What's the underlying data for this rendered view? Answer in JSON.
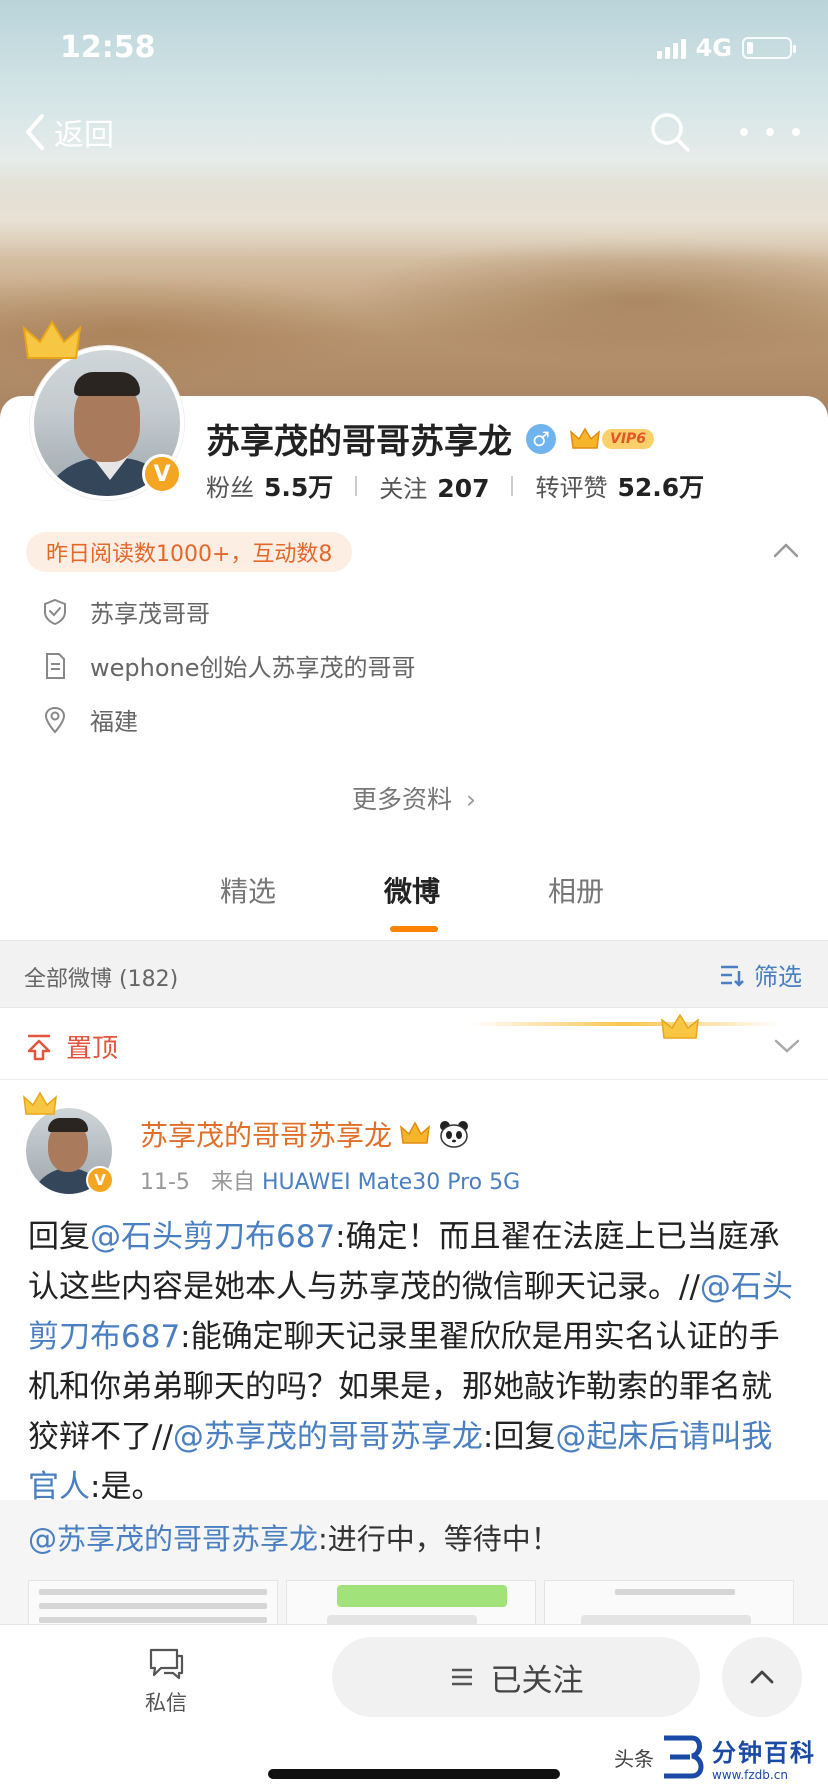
{
  "status_bar": {
    "time": "12:58",
    "network": "4G",
    "battery_level": 0.15
  },
  "nav": {
    "back_label": "返回"
  },
  "profile": {
    "name": "苏享茂的哥哥苏享龙",
    "gender_symbol": "♂",
    "verified_mark": "V",
    "vip_label": "VIP6",
    "stats": [
      {
        "label": "粉丝",
        "value": "5.5万"
      },
      {
        "label": "关注",
        "value": "207"
      },
      {
        "label": "转评赞",
        "value": "52.6万"
      }
    ],
    "read_badge": "昨日阅读数1000+，互动数8",
    "info": [
      {
        "icon": "shield-icon",
        "text": "苏享茂哥哥"
      },
      {
        "icon": "document-icon",
        "text": "wephone创始人苏享茂的哥哥"
      },
      {
        "icon": "location-pin-icon",
        "text": "福建"
      }
    ],
    "more_info": "更多资料"
  },
  "tabs": [
    {
      "label": "精选",
      "active": false
    },
    {
      "label": "微博",
      "active": true
    },
    {
      "label": "相册",
      "active": false
    }
  ],
  "filter": {
    "all_label": "全部微博 (182)",
    "filter_label": "筛选"
  },
  "pinned": {
    "label": "置顶"
  },
  "post": {
    "author": "苏享茂的哥哥苏享龙",
    "date": "11-5",
    "source_prefix": "来自",
    "source": "HUAWEI Mate30 Pro 5G",
    "text": {
      "p1": "回复",
      "at1": "@石头剪刀布687",
      "p2": ":确定！而且翟在法庭上已当庭承认这些内容是她本人与苏享茂的微信聊天记录。//",
      "at2": "@石头剪刀布687",
      "p3": ":能确定聊天记录里翟欣欣是用实名认证的手机和你弟弟聊天的吗？如果是，那她敲诈勒索的罪名就狡辩不了//",
      "at3": "@苏享茂的哥哥苏享龙",
      "p4": ":回复",
      "at4": "@起床后请叫我官人",
      "p5": ":是。"
    },
    "quote": {
      "at": "@苏享茂的哥哥苏享龙",
      "text": ":进行中，等待中！"
    }
  },
  "bottom_bar": {
    "dm_label": "私信",
    "follow_label": "已关注"
  },
  "watermark": {
    "prefix": "头条",
    "name": "分钟百科",
    "url": "www.fzdb.cn"
  },
  "colors": {
    "accent": "#ff8200",
    "link": "#4a7fc1",
    "name_orange": "#e06f2a",
    "pin_red": "#e4563c"
  }
}
